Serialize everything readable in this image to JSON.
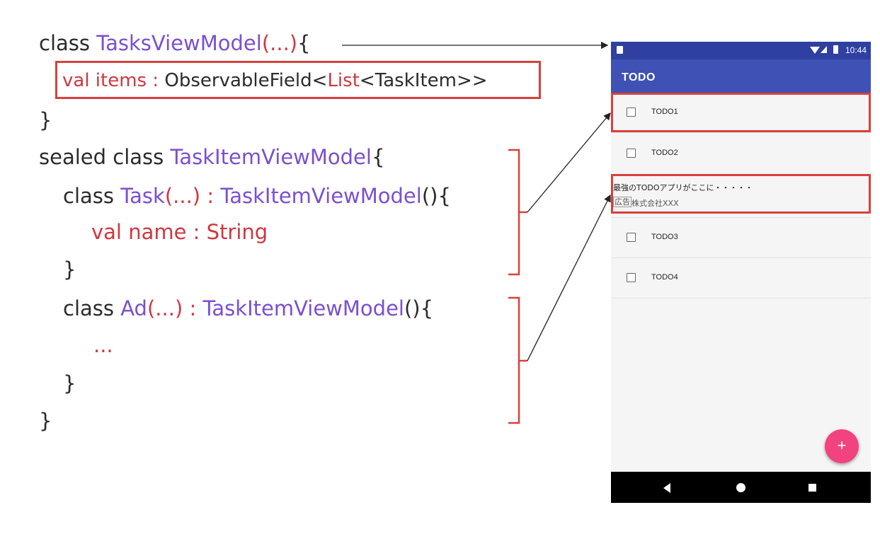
{
  "code": {
    "line1": {
      "kw": "class ",
      "type": "TasksViewModel",
      "args": "(...)",
      "brace": "{"
    },
    "line2": {
      "val": "val items : ",
      "type1": "ObservableField<",
      "type2": "List",
      "type3": "<TaskItem>>"
    },
    "line3": {
      "text": "}"
    },
    "line4": {
      "kw": "sealed class ",
      "type": "TaskItemViewModel",
      "brace": "{"
    },
    "line5": {
      "kw": "class ",
      "type": "Task",
      "args": "(...)",
      "colon": " : ",
      "parent": "TaskItemViewModel",
      "tail": "(){"
    },
    "line6": {
      "text": "val name : String"
    },
    "line7": {
      "text": "}"
    },
    "line8": {
      "kw": "class ",
      "type": "Ad",
      "args": "(...)",
      "colon": " : ",
      "parent": "TaskItemViewModel",
      "tail": "(){"
    },
    "line9": {
      "text": "..."
    },
    "line10": {
      "text": "}"
    },
    "line11": {
      "text": "}"
    }
  },
  "phone": {
    "status_time": "10:44",
    "app_title": "TODO",
    "items": [
      "TODO1",
      "TODO2",
      "TODO3",
      "TODO4"
    ],
    "ad": {
      "title": "最強のTODOアプリがここに・・・・・",
      "badge": "広告",
      "company": "株式会社XXX"
    },
    "fab_label": "+"
  },
  "colors": {
    "accent_purple": "#7b4fd0",
    "accent_red": "#d0373f",
    "app_bar": "#3f51b5",
    "fab": "#f24280"
  }
}
